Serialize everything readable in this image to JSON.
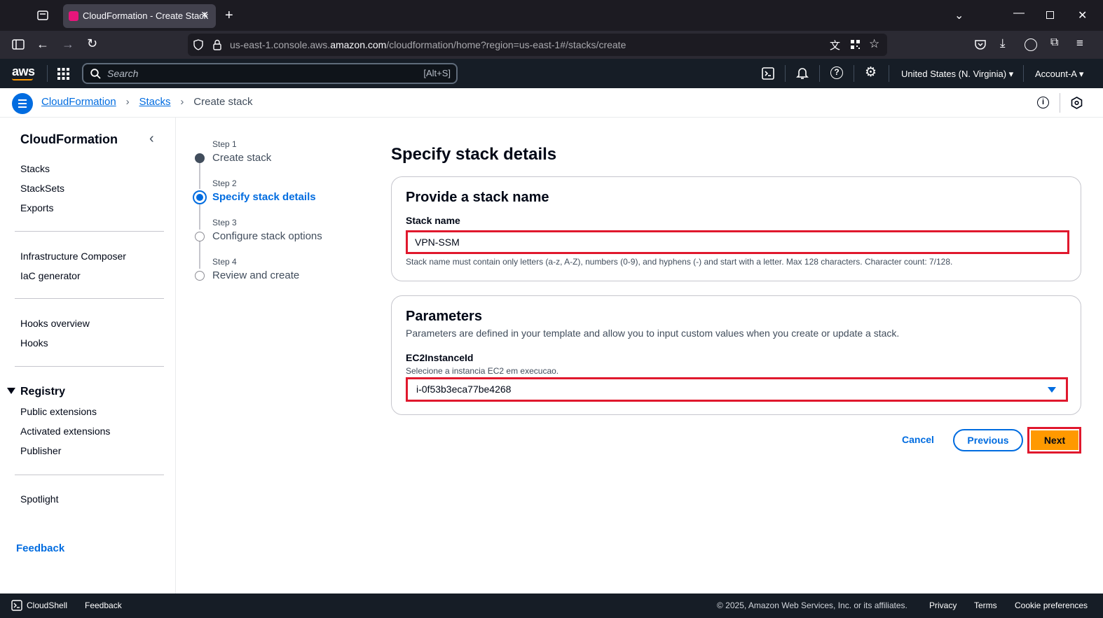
{
  "browser": {
    "tab_title": "CloudFormation - Create Stack",
    "url_prefix": "us-east-1.console.aws.",
    "url_domain": "amazon.com",
    "url_suffix": "/cloudformation/home?region=us-east-1#/stacks/create"
  },
  "aws_header": {
    "logo": "aws",
    "search_placeholder": "Search",
    "search_shortcut": "[Alt+S]",
    "region": "United States (N. Virginia)",
    "account": "Account-A"
  },
  "breadcrumb": {
    "items": [
      "CloudFormation",
      "Stacks"
    ],
    "current": "Create stack"
  },
  "sidebar": {
    "title": "CloudFormation",
    "group1": [
      "Stacks",
      "StackSets",
      "Exports"
    ],
    "group2": [
      "Infrastructure Composer",
      "IaC generator"
    ],
    "group3": [
      "Hooks overview",
      "Hooks"
    ],
    "registry_title": "Registry",
    "registry_items": [
      "Public extensions",
      "Activated extensions",
      "Publisher"
    ],
    "group5": [
      "Spotlight"
    ],
    "feedback": "Feedback"
  },
  "steps": [
    {
      "label": "Step 1",
      "name": "Create stack"
    },
    {
      "label": "Step 2",
      "name": "Specify stack details"
    },
    {
      "label": "Step 3",
      "name": "Configure stack options"
    },
    {
      "label": "Step 4",
      "name": "Review and create"
    }
  ],
  "main": {
    "title": "Specify stack details",
    "stack_card": {
      "heading": "Provide a stack name",
      "field_label": "Stack name",
      "value": "VPN-SSM",
      "hint": "Stack name must contain only letters (a-z, A-Z), numbers (0-9), and hyphens (-) and start with a letter. Max 128 characters. Character count: 7/128."
    },
    "params_card": {
      "heading": "Parameters",
      "description": "Parameters are defined in your template and allow you to input custom values when you create or update a stack.",
      "param_label": "EC2InstanceId",
      "param_hint": "Selecione a instancia EC2 em execucao.",
      "param_value": "i-0f53b3eca77be4268"
    },
    "cancel_label": "Cancel",
    "previous_label": "Previous",
    "next_label": "Next"
  },
  "footer": {
    "cloudshell": "CloudShell",
    "feedback": "Feedback",
    "copyright": "© 2025, Amazon Web Services, Inc. or its affiliates.",
    "privacy": "Privacy",
    "terms": "Terms",
    "cookies": "Cookie preferences"
  }
}
